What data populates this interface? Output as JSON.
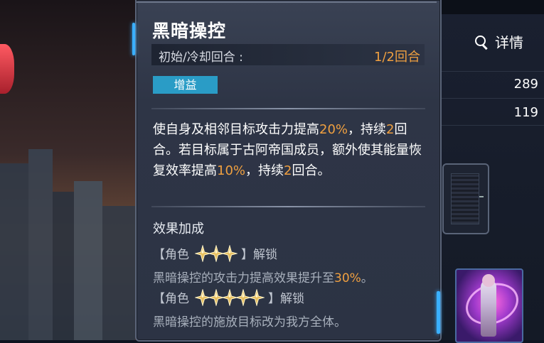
{
  "skill": {
    "title": "黑暗操控",
    "cooldown_label": "初始/冷却回合 :",
    "cooldown_value": "1/2回合",
    "tag": "增益",
    "description": {
      "p1": "使自身及相邻目标攻击力提高",
      "v1": "20%",
      "p2": "，持续",
      "v2": "2",
      "p3": "回合。若目标属于古阿帝国成员，额外使其能量恢复效率提高",
      "v3": "10%",
      "p4": "，持续",
      "v4": "2",
      "p5": "回合。"
    },
    "bonus_title": "效果加成",
    "bonuses": [
      {
        "prefix": "【角色",
        "stars": 3,
        "suffix": "】解锁",
        "desc_pre": "黑暗操控的攻击力提高效果提升至",
        "desc_val": "30%",
        "desc_post": "。"
      },
      {
        "prefix": "【角色",
        "stars": 5,
        "suffix": "】解锁",
        "desc_pre": "黑暗操控的施放目标改为我方全体。",
        "desc_val": "",
        "desc_post": ""
      }
    ]
  },
  "side": {
    "detail_label": "详情",
    "stat_1": "289",
    "stat_2": "119"
  },
  "colors": {
    "accent": "#f0a040",
    "tag_bg": "#2a9cc6",
    "edge_glow": "#3ab0ff"
  }
}
